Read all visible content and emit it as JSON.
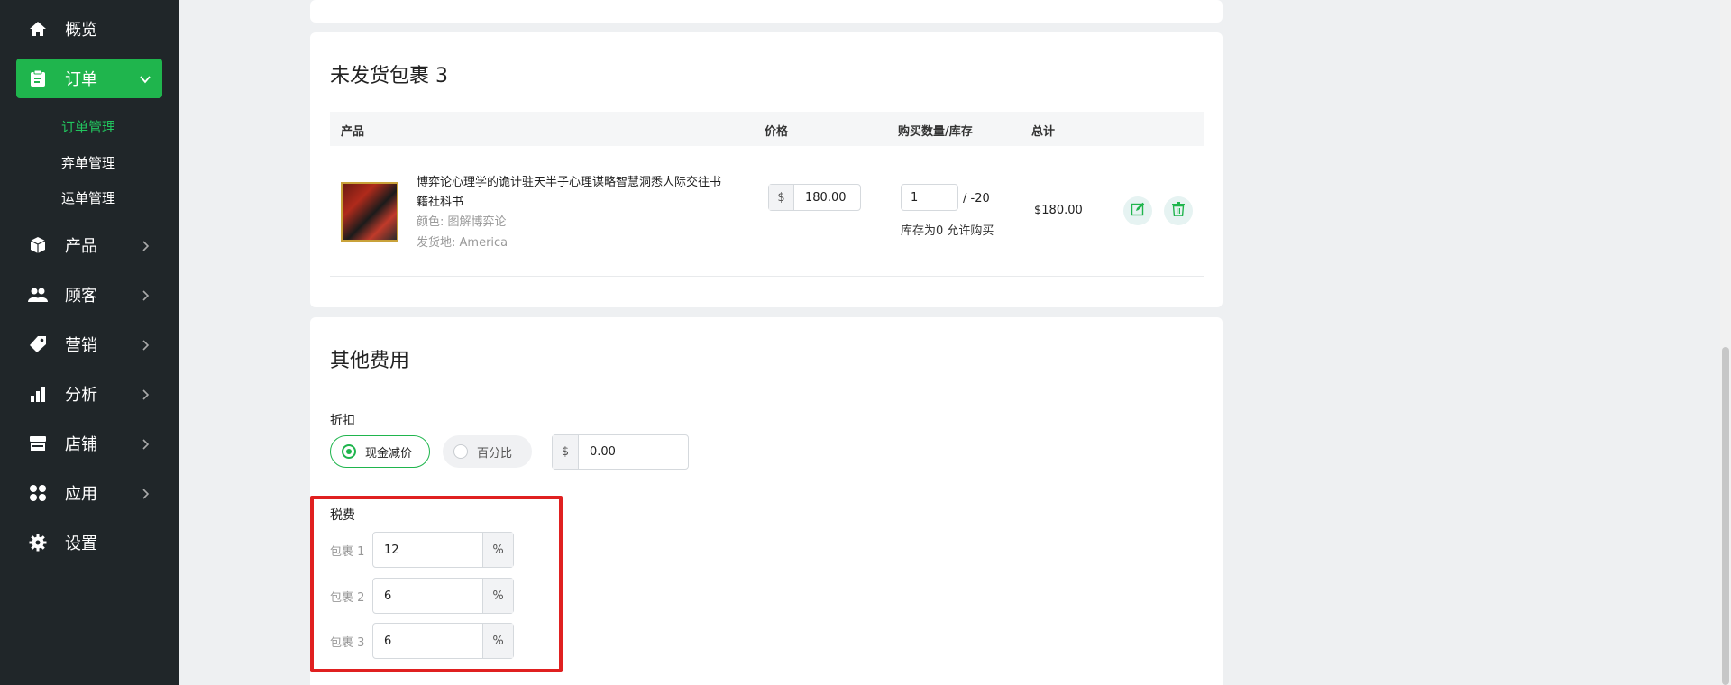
{
  "sidebar": {
    "items": [
      {
        "label": "概览",
        "icon": "home-icon"
      },
      {
        "label": "订单",
        "icon": "clipboard-icon"
      },
      {
        "label": "产品",
        "icon": "box-icon"
      },
      {
        "label": "顾客",
        "icon": "users-icon"
      },
      {
        "label": "营销",
        "icon": "tag-icon"
      },
      {
        "label": "分析",
        "icon": "bar-chart-icon"
      },
      {
        "label": "店铺",
        "icon": "store-icon"
      },
      {
        "label": "应用",
        "icon": "apps-icon"
      },
      {
        "label": "设置",
        "icon": "gear-icon"
      }
    ],
    "order_sub": [
      "订单管理",
      "弃单管理",
      "运单管理"
    ],
    "active_color": "#1fb54d"
  },
  "package": {
    "title": "未发货包裹 3",
    "headers": {
      "product": "产品",
      "price": "价格",
      "qty_stock": "购买数量/库存",
      "total": "总计"
    },
    "item": {
      "name_line1": "博弈论心理学的诡计驻天半子心理谋略智慧洞悉人际交往书",
      "name_line2": "籍社科书",
      "color": "颜色: 图解博弈论",
      "ship_from": "发货地: America",
      "currency": "$",
      "price": "180.00",
      "qty": "1",
      "stock": "/ -20",
      "stock_note": "库存为0 允许购买",
      "total": "$180.00"
    }
  },
  "fees": {
    "title": "其他费用",
    "discount_label": "折扣",
    "discount_options": [
      "现金减价",
      "百分比"
    ],
    "discount_selected": "现金减价",
    "discount_currency": "$",
    "discount_value": "0.00",
    "tax_label": "税费",
    "taxes": [
      {
        "label": "包裹 1",
        "value": "12",
        "unit": "%"
      },
      {
        "label": "包裹 2",
        "value": "6",
        "unit": "%"
      },
      {
        "label": "包裹 3",
        "value": "6",
        "unit": "%"
      }
    ]
  }
}
